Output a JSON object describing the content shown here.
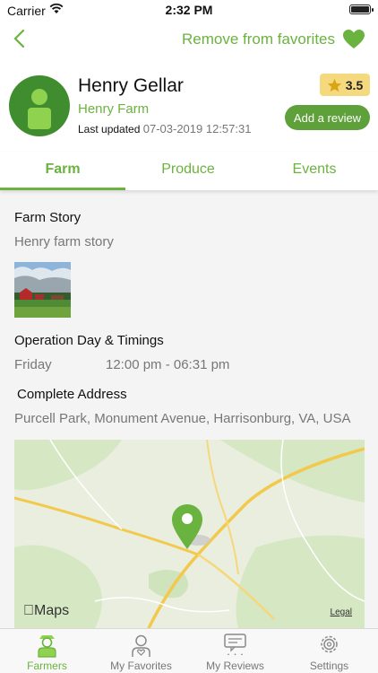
{
  "status_bar": {
    "carrier": "Carrier",
    "time": "2:32 PM"
  },
  "nav": {
    "favorite_label": "Remove from favorites"
  },
  "profile": {
    "name": "Henry Gellar",
    "farm_name": "Henry Farm",
    "updated_label": "Last updated",
    "updated_date": "07-03-2019 12:57:31",
    "rating": "3.5",
    "add_review_label": "Add a review"
  },
  "tabs": [
    {
      "label": "Farm",
      "active": true
    },
    {
      "label": "Produce",
      "active": false
    },
    {
      "label": "Events",
      "active": false
    }
  ],
  "farm": {
    "story_title": "Farm Story",
    "story_text": "Henry farm story",
    "timings_title": "Operation Day & Timings",
    "timings_day": "Friday",
    "timings_hours": "12:00 pm - 06:31 pm",
    "address_title": "Complete Address",
    "address_text": "Purcell Park, Monument Avenue, Harrisonburg, VA, USA"
  },
  "map": {
    "logo_label": "Maps",
    "legal_label": "Legal"
  },
  "tabbar": [
    {
      "label": "Farmers",
      "icon": "farmer-icon",
      "active": true
    },
    {
      "label": "My Favorites",
      "icon": "favorites-icon",
      "active": false
    },
    {
      "label": "My Reviews",
      "icon": "reviews-icon",
      "active": false
    },
    {
      "label": "Settings",
      "icon": "gear-icon",
      "active": false
    }
  ],
  "colors": {
    "accent": "#6bb33f",
    "button": "#5ea03a",
    "rating_bg": "#f4d97e",
    "avatar": "#3f8d2f"
  }
}
